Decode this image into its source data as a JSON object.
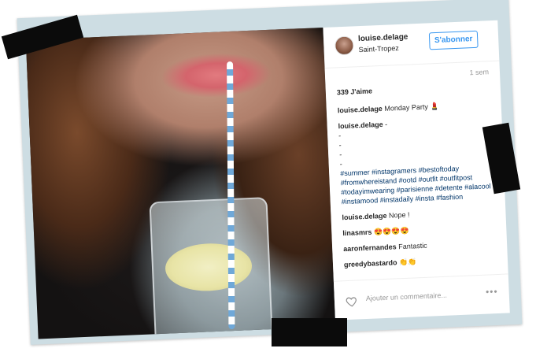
{
  "post": {
    "username": "louise.delage",
    "location": "Saint-Tropez",
    "follow_label": "S'abonner",
    "time": "1 sem",
    "likes": "339 J'aime",
    "caption_user": "louise.delage",
    "caption_text": "Monday Party 💄",
    "comment1_user": "louise.delage",
    "comment1_text": "-",
    "dashes": [
      "-",
      "-",
      "-",
      "-"
    ],
    "hashtags": "#summer #instagramers #bestoftoday #fromwhereistand #ootd #outfit #outfitpost #todayimwearing #parisienne #detente #alacool #instamood #instadaily #insta #fashion",
    "comment2_user": "louise.delage",
    "comment2_text": "Nope !",
    "comment3_user": "linasmrs",
    "comment3_text": "😍😍😍😍",
    "comment4_user": "aaronfernandes",
    "comment4_text": "Fantastic",
    "comment5_user": "greedybastardo",
    "comment5_text": "👏👏",
    "add_comment_placeholder": "Ajouter un commentaire...",
    "more_label": "•••"
  },
  "icons": {
    "heart": "heart-icon",
    "more": "more-options-icon"
  },
  "colors": {
    "link_blue": "#3897f0",
    "hashtag_blue": "#003569",
    "frame_bg": "#cddde3",
    "tape": "#0b0b0b"
  }
}
